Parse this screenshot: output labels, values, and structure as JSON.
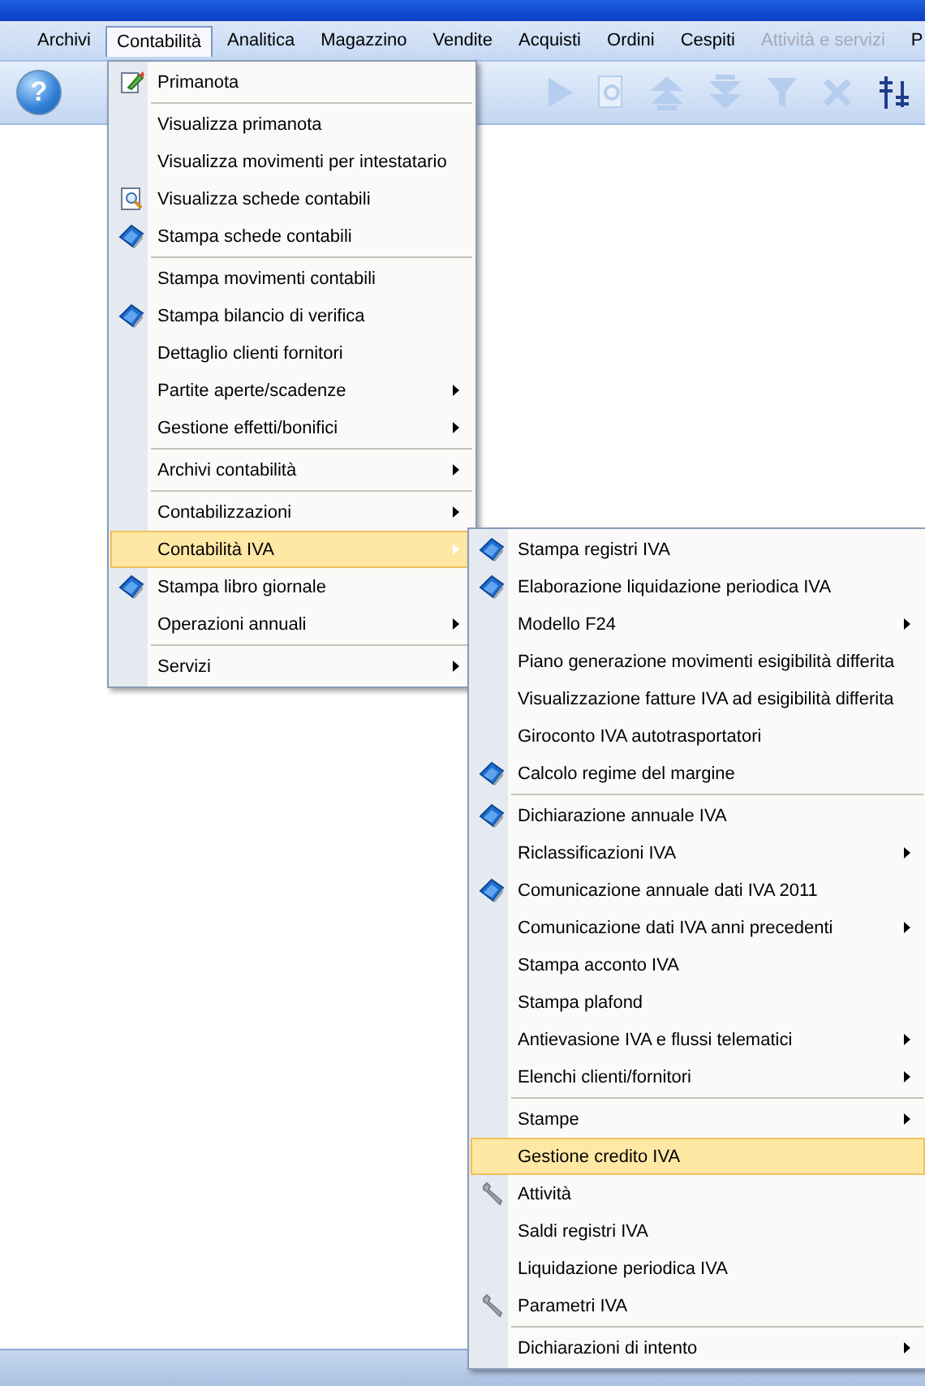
{
  "menu_bar": [
    {
      "label": "Archivi",
      "selected": false,
      "disabled": false
    },
    {
      "label": "Contabilità",
      "selected": true,
      "disabled": false
    },
    {
      "label": "Analitica",
      "selected": false,
      "disabled": false
    },
    {
      "label": "Magazzino",
      "selected": false,
      "disabled": false
    },
    {
      "label": "Vendite",
      "selected": false,
      "disabled": false
    },
    {
      "label": "Acquisti",
      "selected": false,
      "disabled": false
    },
    {
      "label": "Ordini",
      "selected": false,
      "disabled": false
    },
    {
      "label": "Cespiti",
      "selected": false,
      "disabled": false
    },
    {
      "label": "Attività e servizi",
      "selected": false,
      "disabled": true
    },
    {
      "label": "P",
      "selected": false,
      "disabled": false
    }
  ],
  "toolbar": {
    "help_glyph": "?"
  },
  "menu": {
    "groups": [
      [
        {
          "label": "Primanota",
          "kind": "edit",
          "submenu": false,
          "selected": false
        }
      ],
      [
        {
          "label": "Visualizza primanota",
          "kind": "plain",
          "submenu": false,
          "selected": false
        },
        {
          "label": "Visualizza movimenti per intestatario",
          "kind": "plain",
          "submenu": false,
          "selected": false
        },
        {
          "label": "Visualizza schede contabili",
          "kind": "view",
          "submenu": false,
          "selected": false
        },
        {
          "label": "Stampa schede contabili",
          "kind": "print",
          "submenu": false,
          "selected": false
        }
      ],
      [
        {
          "label": "Stampa movimenti contabili",
          "kind": "plain",
          "submenu": false,
          "selected": false
        },
        {
          "label": "Stampa bilancio di verifica",
          "kind": "print",
          "submenu": false,
          "selected": false
        },
        {
          "label": "Dettaglio clienti fornitori",
          "kind": "plain",
          "submenu": false,
          "selected": false
        },
        {
          "label": "Partite aperte/scadenze",
          "kind": "plain",
          "submenu": true,
          "selected": false
        },
        {
          "label": "Gestione effetti/bonifici",
          "kind": "plain",
          "submenu": true,
          "selected": false
        }
      ],
      [
        {
          "label": "Archivi contabilità",
          "kind": "plain",
          "submenu": true,
          "selected": false
        }
      ],
      [
        {
          "label": "Contabilizzazioni",
          "kind": "plain",
          "submenu": true,
          "selected": false
        },
        {
          "label": "Contabilità IVA",
          "kind": "plain",
          "submenu": true,
          "selected": true
        },
        {
          "label": "Stampa libro giornale",
          "kind": "print",
          "submenu": false,
          "selected": false
        },
        {
          "label": "Operazioni annuali",
          "kind": "plain",
          "submenu": true,
          "selected": false
        }
      ],
      [
        {
          "label": "Servizi",
          "kind": "plain",
          "submenu": true,
          "selected": false
        }
      ]
    ]
  },
  "submenu": {
    "groups": [
      [
        {
          "label": "Stampa registri IVA",
          "kind": "print",
          "submenu": false,
          "selected": false
        },
        {
          "label": "Elaborazione liquidazione periodica IVA",
          "kind": "print",
          "submenu": false,
          "selected": false
        },
        {
          "label": "Modello F24",
          "kind": "plain",
          "submenu": true,
          "selected": false
        },
        {
          "label": "Piano generazione movimenti esigibilità differita",
          "kind": "plain",
          "submenu": false,
          "selected": false
        },
        {
          "label": "Visualizzazione fatture IVA ad esigibilità differita",
          "kind": "plain",
          "submenu": false,
          "selected": false
        },
        {
          "label": "Giroconto IVA autotrasportatori",
          "kind": "plain",
          "submenu": false,
          "selected": false
        },
        {
          "label": "Calcolo regime del margine",
          "kind": "print",
          "submenu": false,
          "selected": false
        }
      ],
      [
        {
          "label": "Dichiarazione annuale IVA",
          "kind": "print",
          "submenu": false,
          "selected": false
        },
        {
          "label": "Riclassificazioni IVA",
          "kind": "plain",
          "submenu": true,
          "selected": false
        },
        {
          "label": "Comunicazione annuale dati IVA 2011",
          "kind": "print",
          "submenu": false,
          "selected": false
        },
        {
          "label": "Comunicazione dati IVA anni precedenti",
          "kind": "plain",
          "submenu": true,
          "selected": false
        },
        {
          "label": "Stampa acconto IVA",
          "kind": "plain",
          "submenu": false,
          "selected": false
        },
        {
          "label": "Stampa plafond",
          "kind": "plain",
          "submenu": false,
          "selected": false
        },
        {
          "label": "Antievasione IVA e flussi telematici",
          "kind": "plain",
          "submenu": true,
          "selected": false
        },
        {
          "label": "Elenchi clienti/fornitori",
          "kind": "plain",
          "submenu": true,
          "selected": false
        }
      ],
      [
        {
          "label": "Stampe",
          "kind": "plain",
          "submenu": true,
          "selected": false
        },
        {
          "label": "Gestione credito IVA",
          "kind": "plain",
          "submenu": false,
          "selected": true
        },
        {
          "label": "Attività",
          "kind": "tool",
          "submenu": false,
          "selected": false
        },
        {
          "label": "Saldi registri IVA",
          "kind": "plain",
          "submenu": false,
          "selected": false
        },
        {
          "label": "Liquidazione periodica IVA",
          "kind": "plain",
          "submenu": false,
          "selected": false
        },
        {
          "label": "Parametri IVA",
          "kind": "tool",
          "submenu": false,
          "selected": false
        }
      ],
      [
        {
          "label": "Dichiarazioni di intento",
          "kind": "plain",
          "submenu": true,
          "selected": false
        }
      ]
    ]
  }
}
